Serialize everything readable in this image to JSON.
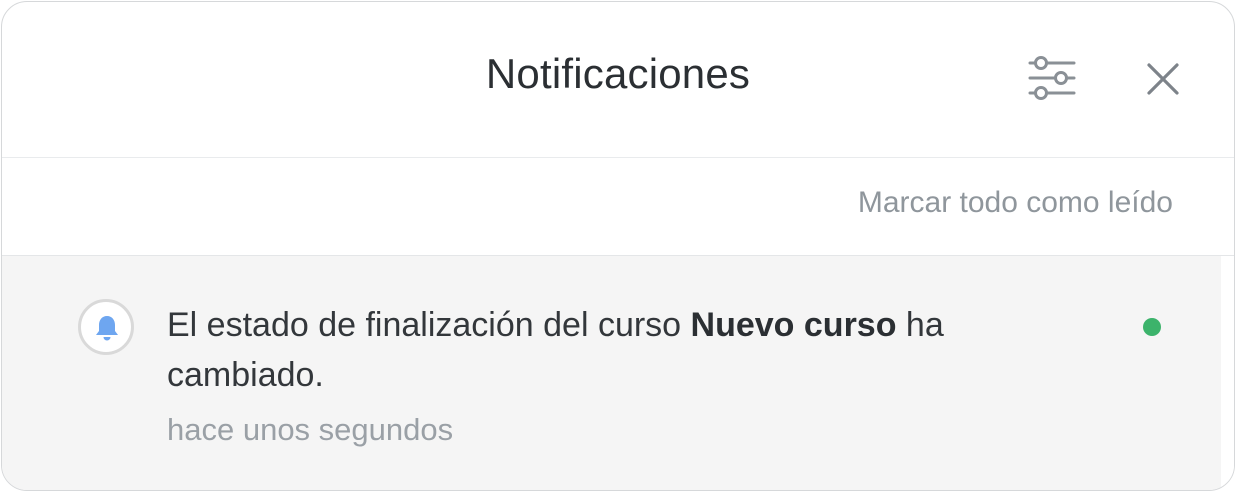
{
  "header": {
    "title": "Notificaciones",
    "settings_icon": "sliders-icon",
    "close_icon": "close-icon"
  },
  "actions": {
    "mark_all_read": "Marcar todo como leído"
  },
  "notifications": [
    {
      "icon": "bell-icon",
      "text_before": "El estado de finalización del curso ",
      "text_bold": "Nuevo curso",
      "text_after": " ha cambiado.",
      "time": "hace unos segundos",
      "unread": true
    }
  ],
  "colors": {
    "unread_dot": "#3cb36b",
    "bell": "#6ea6f0",
    "list_background": "#f5f5f5"
  }
}
